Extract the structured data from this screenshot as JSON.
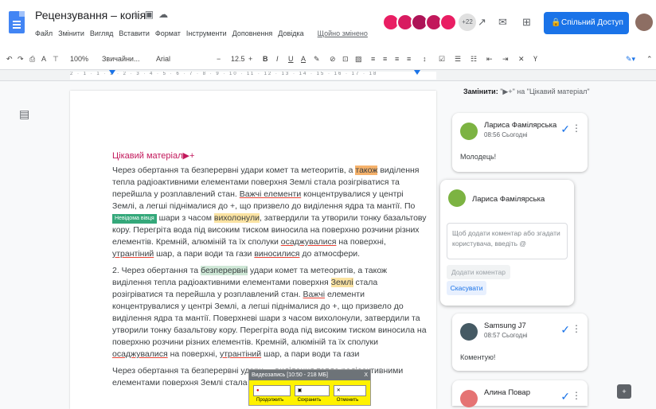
{
  "header": {
    "doc_title": "Рецензування – копія",
    "menu": [
      "Файл",
      "Змінити",
      "Вигляд",
      "Вставити",
      "Формат",
      "Інструменти",
      "Доповнення",
      "Довідка"
    ],
    "last_edit": "Щойно змінено",
    "avatars_more": "+22",
    "share_label": "Спільний Доступ",
    "accent": "#1a73e8"
  },
  "toolbar": {
    "zoom": "100%",
    "style": "Звичайни...",
    "font": "Arial",
    "font_size": "12.5",
    "bold": "B",
    "italic": "I",
    "underline": "U",
    "text_color": "A",
    "minus": "−",
    "plus": "+",
    "clear": "Ү",
    "pen_icon": "pencil-icon"
  },
  "ruler": {
    "ticks": "2  ·  1  ·  1  ·  1  ·  2  ·  3  ·  4  ·  5  ·  6  ·  7  ·  8  ·  9  ·  10  ·  11  ·  12  ·  13  ·  14  ·  15  ·  16  ·  17  ·  18"
  },
  "document": {
    "heading": "Цікавий матеріал",
    "heading_mark": "▶+",
    "p1": {
      "a": "Через обертання та безперервні удари комет та метеоритів, а ",
      "b": "також",
      "c": " виділення тепла радіоактивними елементами поверхня Землі стала розігріватися та перейшла у розплавлений стан. ",
      "d": "Важчі елементи",
      "e": " концентрувалися у центрі Землі, а легші піднімалися до +, що призвело до виділення ядра та мантії. По",
      "cursor": "Невідома вівця",
      "f": "шари з часом ",
      "g": "вихолонули",
      "h": ", затвердили та утворили тонку базальтову кору. Перегріта вода під високим тиском виносила на поверхню розчини різних елементів. Кремній, алюміній та їх сполуки ",
      "i": "осаджувалися",
      "j": " на поверхні, ",
      "k": "утрантіний",
      "l": " шар, а пари води та гази ",
      "m": "виносилися",
      "n": " до атмосфери."
    },
    "p2": {
      "a": "2. Через обертання та ",
      "b": "безперервні",
      "c": " удари комет та метеоритів, а також виділення тепла радіоактивними елементами поверхня ",
      "d": "Землі",
      "e": " стала розігріватися та перейшла у розплавлений стан. ",
      "f": "Важчі",
      "g": " елементи концентрувалися у центрі Землі, а легші піднімалися до +, що призвело до виділення ядра та мантії. Поверхневі шари з часом вихолонули, затвердили та утворили тонку базальтову кору. Перегріта вода під високим тиском виносила на поверхню розчини різних елементів. Кремній, алюміній та їх сполуки ",
      "h": "осаджувалися",
      "i": " на поверхні, ",
      "j": "утрантіний",
      "k": " шар, а пари води та гази"
    },
    "p3": "Через обертання та безперервні удари ... виділення тепла радіоактивними елементами поверхня Землі стала розігріватися та"
  },
  "recorder": {
    "title": "Видеозапись [10:50 - 218 МБ]",
    "close": "X",
    "resume": "Продолжить",
    "save": "Сохранить",
    "cancel": "Отменить"
  },
  "comments": {
    "changed_prefix": "Замінити:",
    "changed_text": "\"▶+\" на \"Цікавий матеріал\"",
    "c1": {
      "name": "Лариса Фамілярська",
      "time": "08:56 Сьогодні",
      "text": "Молодець!"
    },
    "reply": {
      "name": "Лариса Фамілярська",
      "placeholder": "Щоб додати коментар або згадати користувача, введіть @",
      "add_label": "Додати коментар",
      "cancel_label": "Скасувати"
    },
    "c2": {
      "name": "Samsung J7",
      "time": "08:57 Сьогодні",
      "text": "Коментую!"
    },
    "c3": {
      "name": "Алина Повар",
      "time": "08:57 Сьогодні"
    }
  }
}
